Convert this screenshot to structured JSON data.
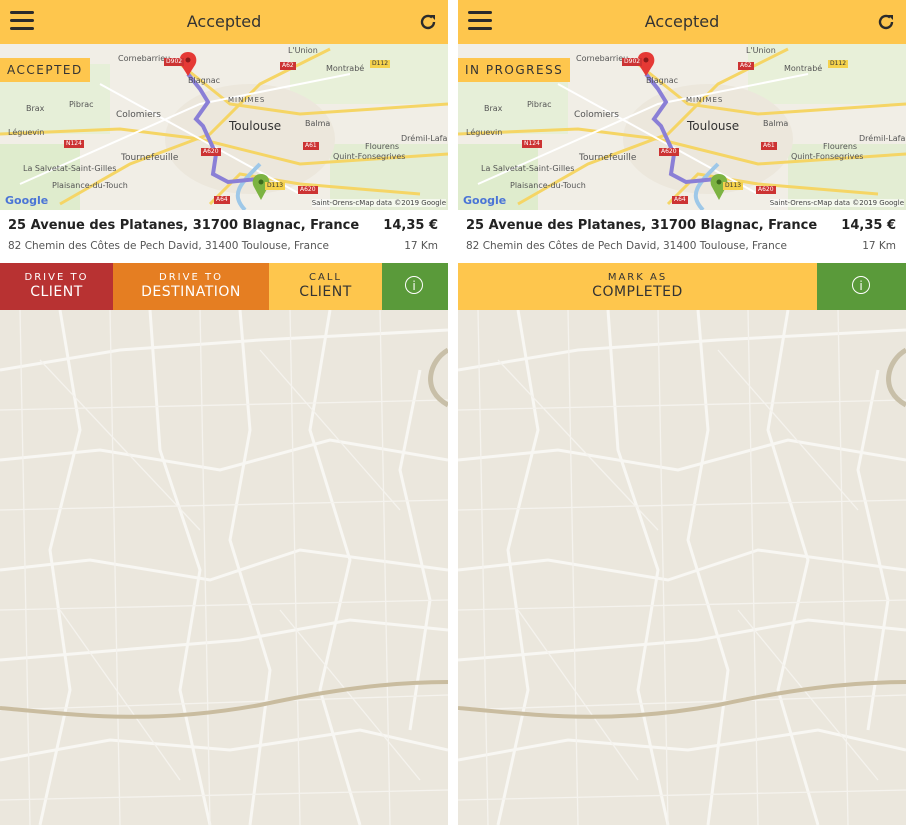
{
  "screens": [
    {
      "title": "Accepted",
      "status_tag": "ACCEPTED",
      "trip": {
        "from": "25 Avenue des Platanes, 31700 Blagnac, France",
        "to": "82 Chemin des Côtes de Pech David, 31400 Toulouse, France",
        "price": "14,35 €",
        "distance": "17 Km"
      },
      "actions": [
        {
          "top": "DRIVE TO",
          "main": "CLIENT",
          "color": "#b83232"
        },
        {
          "top": "DRIVE TO",
          "main": "DESTINATION",
          "color": "#e57e22"
        },
        {
          "top": "CALL",
          "main": "CLIENT",
          "color": "#fec64d"
        }
      ],
      "info_icon": "i"
    },
    {
      "title": "Accepted",
      "status_tag": "IN PROGRESS",
      "trip": {
        "from": "25 Avenue des Platanes, 31700 Blagnac, France",
        "to": "82 Chemin des Côtes de Pech David, 31400 Toulouse, France",
        "price": "14,35 €",
        "distance": "17 Km"
      },
      "actions": [
        {
          "top": "MARK AS",
          "main": "COMPLETED",
          "color": "#fec64d"
        }
      ],
      "info_icon": "i"
    }
  ],
  "map": {
    "labels": [
      "Cornebarrieu",
      "L'Union",
      "Blagnac",
      "Montrabé",
      "MINIMES",
      "Pibrac",
      "Brax",
      "Colomiers",
      "Toulouse",
      "Balma",
      "Léguevin",
      "Drémil-Lafa",
      "Flourens",
      "Tournefeuille",
      "Quint-Fonsegrives",
      "La Salvetat-Saint-Gilles",
      "Plaisance-du-Touch",
      "Saint-Orens-c"
    ],
    "roads": [
      "D902",
      "A62",
      "D112",
      "N124",
      "A620",
      "A61",
      "D113",
      "A64",
      "A620"
    ],
    "google": "Google",
    "attribution": "Map data ©2019 Google"
  },
  "icons": {
    "menu": "menu-icon",
    "refresh": "refresh-icon",
    "info": "info-icon",
    "start_pin": "map-pin-start-icon",
    "end_pin": "map-pin-end-icon"
  },
  "colors": {
    "header": "#fec64d",
    "drive_client": "#b83232",
    "drive_destination": "#e57e22",
    "call_client": "#fec64d",
    "info": "#5a9a3a",
    "route": "#8a7fd6"
  }
}
